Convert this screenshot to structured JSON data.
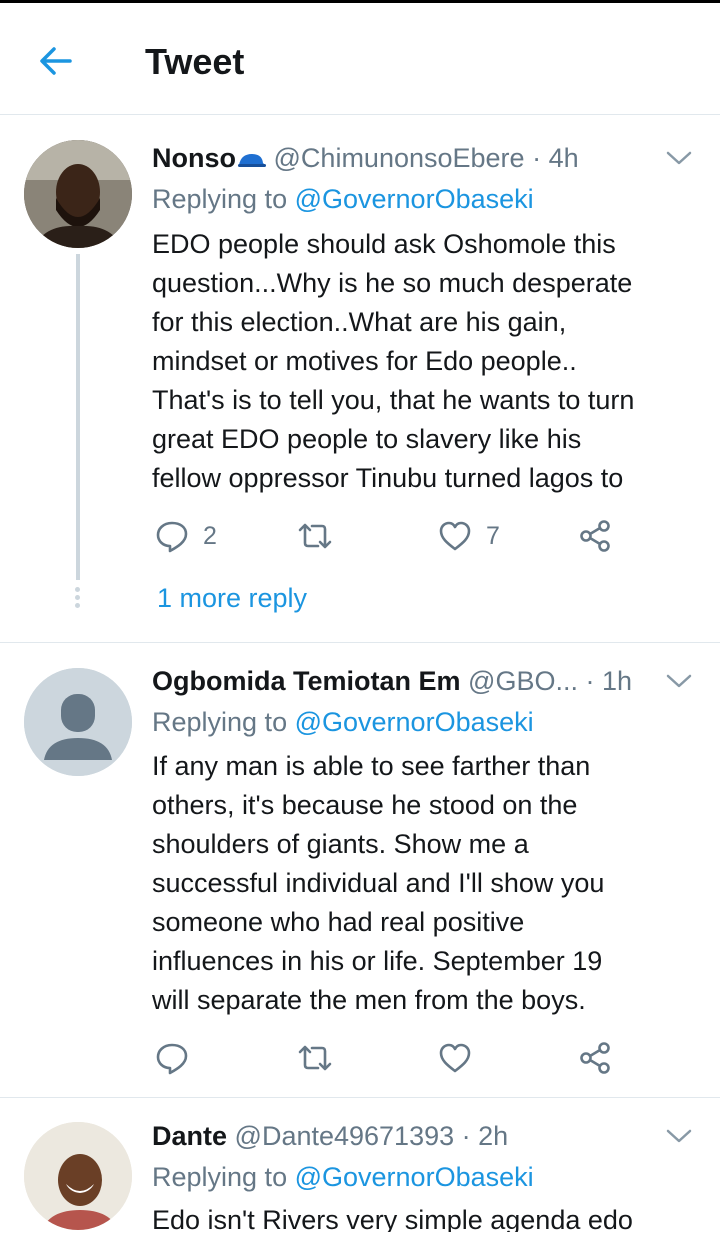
{
  "header": {
    "title": "Tweet",
    "back_icon": "arrow-left-icon"
  },
  "colors": {
    "accent": "#1b95e0",
    "secondary_text": "#657786",
    "divider": "#e1e8ed"
  },
  "tweets": [
    {
      "name": "Nonso",
      "name_emoji": "cap",
      "handle": "@ChimunonsoEbere",
      "time": "4h",
      "replying_prefix": "Replying to",
      "replying_to": "@GovernorObaseki",
      "text": "EDO people should ask Oshomole this\nquestion...Why is he so much desperate\nfor this election..What are his gain,\nmindset or motives for Edo people..\nThat's is to tell you, that he wants to turn\ngreat EDO people to slavery like his\nfellow oppressor Tinubu turned lagos to",
      "reply_count": "2",
      "retweet_count": "",
      "like_count": "7",
      "more_replies": "1 more reply"
    },
    {
      "name": "Ogbomida Temiotan Em",
      "handle": "@GBO...",
      "time": "1h",
      "replying_prefix": "Replying to",
      "replying_to": "@GovernorObaseki",
      "text": "If any man is able to see farther than\nothers, it's because he stood on the\nshoulders of giants. Show me a\nsuccessful individual and I'll show you\nsomeone who had real positive\ninfluences in his or life. September 19\nwill separate the men from the boys.",
      "reply_count": "",
      "retweet_count": "",
      "like_count": ""
    },
    {
      "name": "Dante",
      "handle": "@Dante49671393",
      "time": "2h",
      "replying_prefix": "Replying to",
      "replying_to": "@GovernorObaseki",
      "text": "Edo isn't Rivers very simple agenda edo"
    }
  ]
}
